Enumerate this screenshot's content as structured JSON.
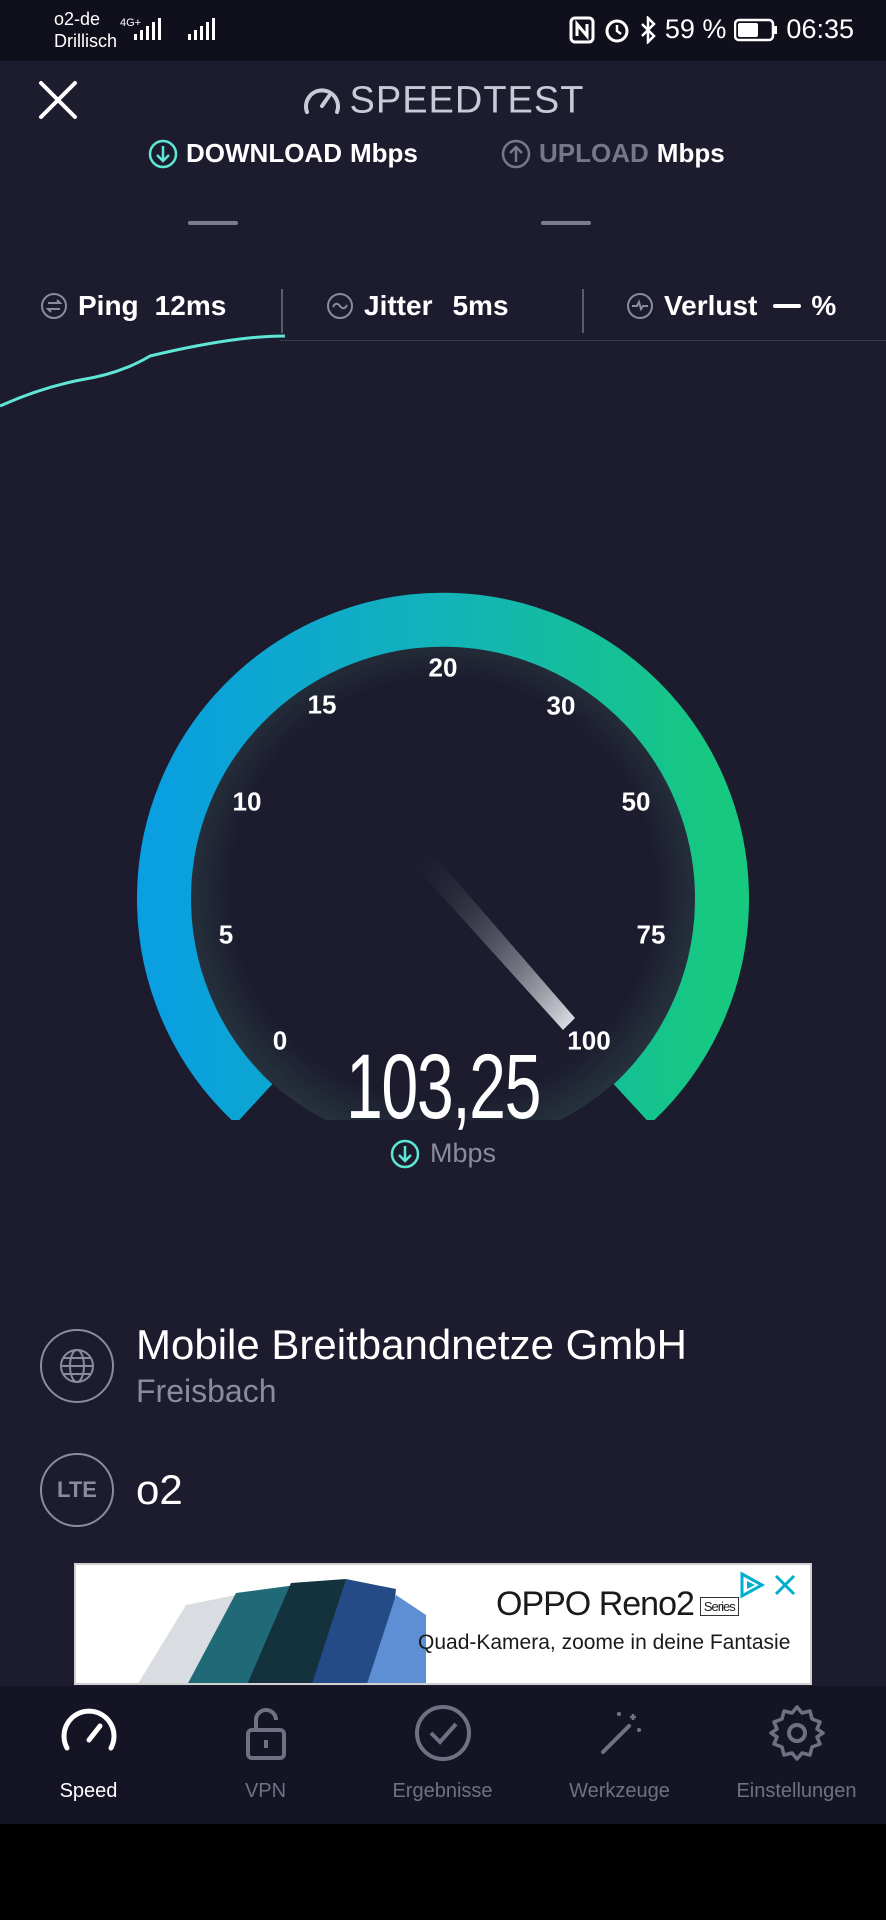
{
  "status_bar": {
    "carrier_line1": "o2-de",
    "carrier_line2": "Drillisch",
    "network": "4G+",
    "battery": "59 %",
    "time": "06:35"
  },
  "header": {
    "title": "SPEEDTEST",
    "download_label": "DOWNLOAD",
    "download_unit": "Mbps",
    "upload_label": "UPLOAD",
    "upload_unit": "Mbps"
  },
  "metrics": {
    "ping_label": "Ping",
    "ping_value": "12ms",
    "jitter_label": "Jitter",
    "jitter_value": "5ms",
    "loss_label": "Verlust",
    "loss_unit": "%"
  },
  "gauge": {
    "ticks": [
      "0",
      "5",
      "10",
      "15",
      "20",
      "30",
      "50",
      "75",
      "100"
    ],
    "value": "103,25",
    "unit": "Mbps"
  },
  "provider": {
    "name": "Mobile Breitbandnetze GmbH",
    "location": "Freisbach",
    "network_badge": "LTE",
    "carrier": "o2"
  },
  "ad": {
    "title": "OPPO Reno2",
    "series": "Series",
    "subtitle": "Quad-Kamera, zoome in deine Fantasie"
  },
  "nav": {
    "items": [
      {
        "label": "Speed",
        "icon": "speedometer-icon"
      },
      {
        "label": "VPN",
        "icon": "lock-icon"
      },
      {
        "label": "Ergebnisse",
        "icon": "check-circle-icon"
      },
      {
        "label": "Werkzeuge",
        "icon": "magic-wand-icon"
      },
      {
        "label": "Einstellungen",
        "icon": "gear-icon"
      }
    ]
  },
  "colors": {
    "background": "#1c1c2e",
    "accent_cyan": "#5fe6d6",
    "gauge_start": "#0a9fe0",
    "gauge_end": "#16c97f"
  }
}
